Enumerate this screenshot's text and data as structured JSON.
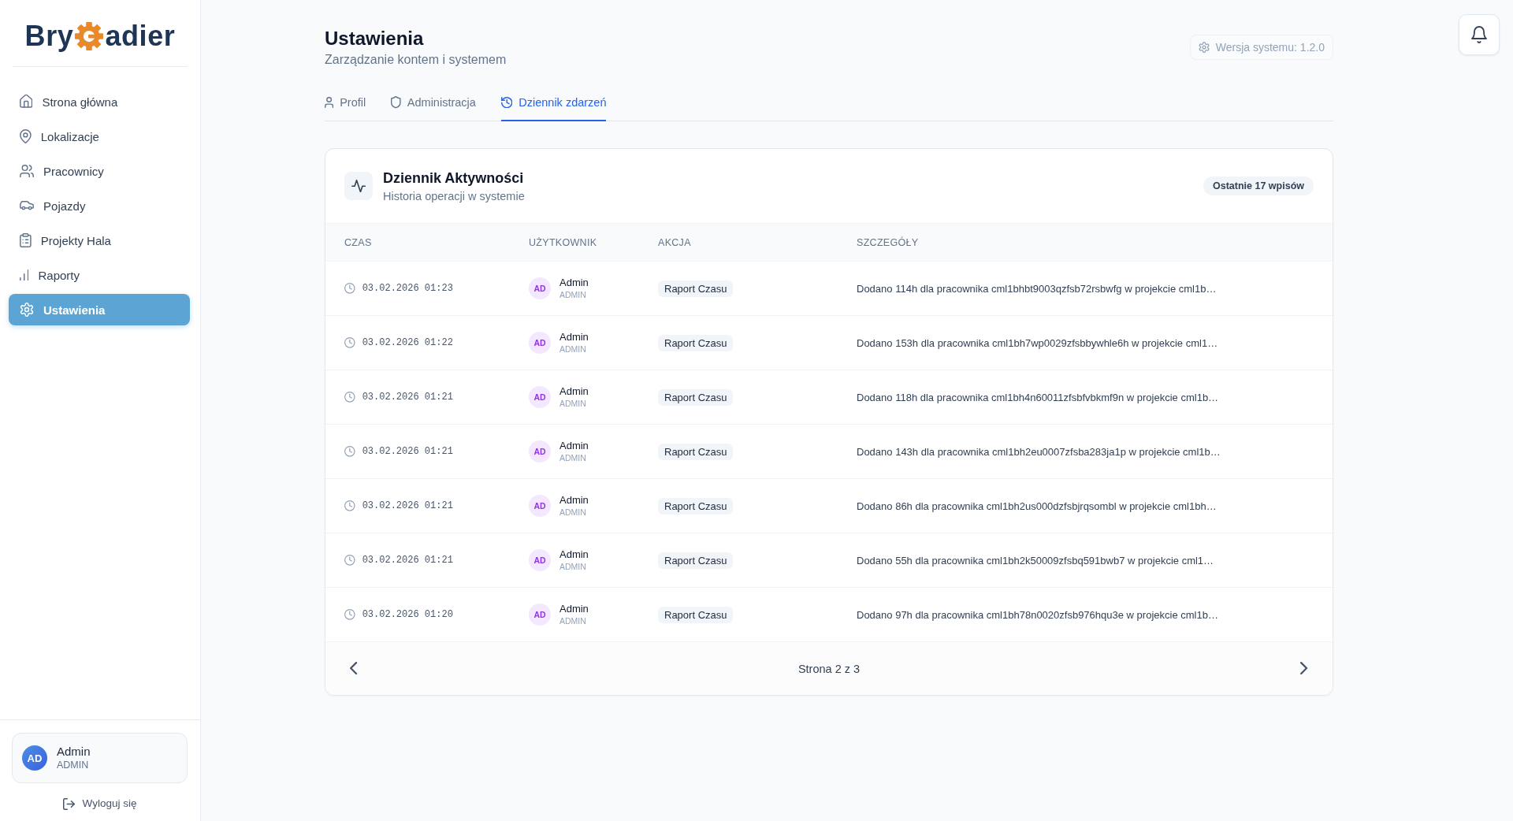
{
  "sidebar": {
    "logo": {
      "text_before": "Bry",
      "text_after": "adier"
    },
    "nav": [
      {
        "label": "Strona główna",
        "selected": false
      },
      {
        "label": "Lokalizacje",
        "selected": false
      },
      {
        "label": "Pracownicy",
        "selected": false
      },
      {
        "label": "Pojazdy",
        "selected": false
      },
      {
        "label": "Projekty Hala",
        "selected": false
      },
      {
        "label": "Raporty",
        "selected": false
      },
      {
        "label": "Ustawienia",
        "selected": true
      }
    ],
    "user": {
      "initials": "AD",
      "name": "Admin",
      "role": "ADMIN"
    },
    "logout": "Wyloguj się"
  },
  "header": {
    "title": "Ustawienia",
    "subtitle": "Zarządzanie kontem i systemem",
    "version": "Wersja systemu: 1.2.0"
  },
  "tabs": [
    {
      "label": "Profil",
      "selected": false
    },
    {
      "label": "Administracja",
      "selected": false
    },
    {
      "label": "Dziennik zdarzeń",
      "selected": true
    }
  ],
  "activity_log": {
    "title": "Dziennik Aktywności",
    "subtitle": "Historia operacji w systemie",
    "badge": "Ostatnie 17 wpisów",
    "columns": [
      "CZAS",
      "UŻYTKOWNIK",
      "AKCJA",
      "SZCZEGÓŁY"
    ],
    "rows": [
      {
        "time": "03.02.2026 01:23",
        "user_initials": "AD",
        "user_name": "Admin",
        "user_role": "ADMIN",
        "action": "Raport Czasu",
        "details": "Dodano 114h dla pracownika cml1bhbt9003qzfsb72rsbwfg w projekcie cml1b…"
      },
      {
        "time": "03.02.2026 01:22",
        "user_initials": "AD",
        "user_name": "Admin",
        "user_role": "ADMIN",
        "action": "Raport Czasu",
        "details": "Dodano 153h dla pracownika cml1bh7wp0029zfsbbywhle6h w projekcie cml1…"
      },
      {
        "time": "03.02.2026 01:21",
        "user_initials": "AD",
        "user_name": "Admin",
        "user_role": "ADMIN",
        "action": "Raport Czasu",
        "details": "Dodano 118h dla pracownika cml1bh4n60011zfsbfvbkmf9n w projekcie cml1b…"
      },
      {
        "time": "03.02.2026 01:21",
        "user_initials": "AD",
        "user_name": "Admin",
        "user_role": "ADMIN",
        "action": "Raport Czasu",
        "details": "Dodano 143h dla pracownika cml1bh2eu0007zfsba283ja1p w projekcie cml1b…"
      },
      {
        "time": "03.02.2026 01:21",
        "user_initials": "AD",
        "user_name": "Admin",
        "user_role": "ADMIN",
        "action": "Raport Czasu",
        "details": "Dodano 86h dla pracownika cml1bh2us000dzfsbjrqsombl w projekcie cml1bh…"
      },
      {
        "time": "03.02.2026 01:21",
        "user_initials": "AD",
        "user_name": "Admin",
        "user_role": "ADMIN",
        "action": "Raport Czasu",
        "details": "Dodano 55h dla pracownika cml1bh2k50009zfsbq591bwb7 w projekcie cml1…"
      },
      {
        "time": "03.02.2026 01:20",
        "user_initials": "AD",
        "user_name": "Admin",
        "user_role": "ADMIN",
        "action": "Raport Czasu",
        "details": "Dodano 97h dla pracownika cml1bh78n0020zfsb976hqu3e w projekcie cml1b…"
      }
    ],
    "pagination": {
      "label": "Strona 2 z 3"
    }
  }
}
